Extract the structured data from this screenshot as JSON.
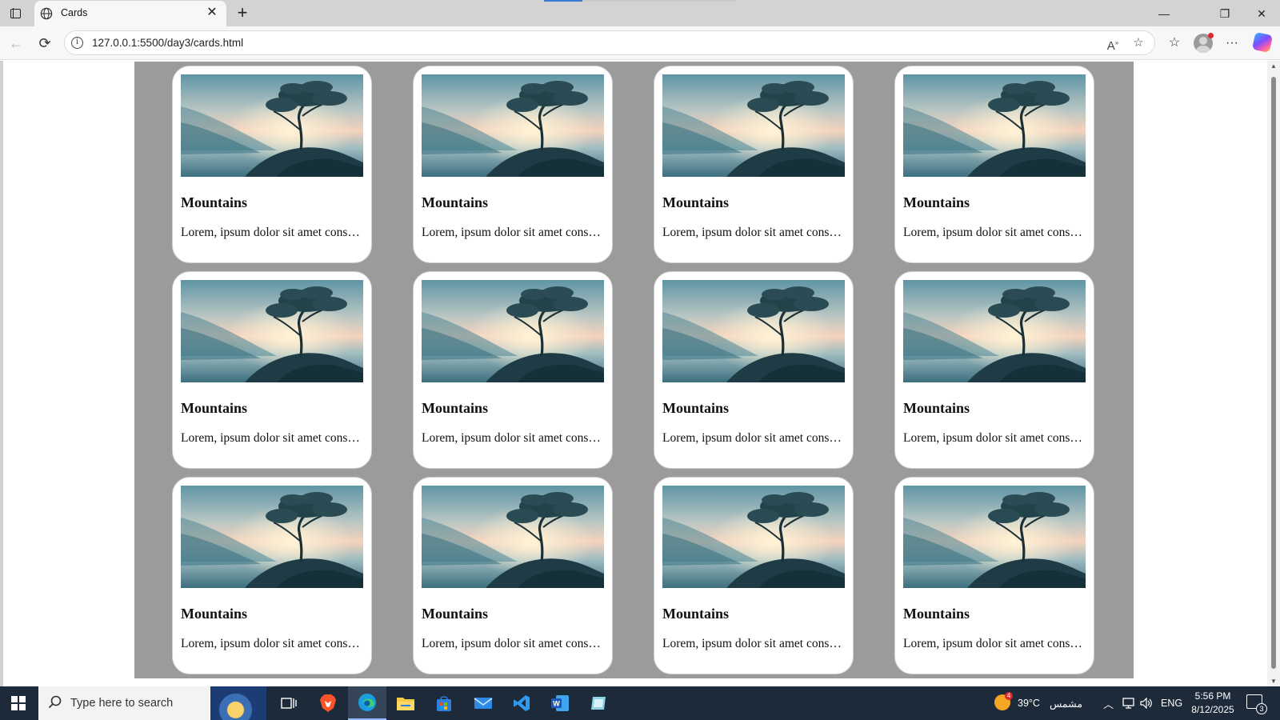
{
  "browser": {
    "tab_title": "Cards",
    "new_tab_label": "+",
    "tab_close_label": "✕",
    "url": "127.0.0.1:5500/day3/cards.html",
    "window_controls": {
      "minimize": "—",
      "restore": "❐",
      "close": "✕"
    },
    "icons": [
      "back-arrow-icon",
      "refresh-icon",
      "info-icon",
      "read-aloud-icon",
      "favorite-star-icon",
      "favorites-icon",
      "profile-icon",
      "more-icon",
      "copilot-icon"
    ]
  },
  "cards": [
    {
      "title": "Mountains",
      "text": "Lorem, ipsum dolor sit amet consectetur adipisicing elit."
    },
    {
      "title": "Mountains",
      "text": "Lorem, ipsum dolor sit amet consectetur adipisicing elit."
    },
    {
      "title": "Mountains",
      "text": "Lorem, ipsum dolor sit amet consectetur adipisicing elit."
    },
    {
      "title": "Mountains",
      "text": "Lorem, ipsum dolor sit amet consectetur adipisicing elit."
    },
    {
      "title": "Mountains",
      "text": "Lorem, ipsum dolor sit amet consectetur adipisicing elit."
    },
    {
      "title": "Mountains",
      "text": "Lorem, ipsum dolor sit amet consectetur adipisicing elit."
    },
    {
      "title": "Mountains",
      "text": "Lorem, ipsum dolor sit amet consectetur adipisicing elit."
    },
    {
      "title": "Mountains",
      "text": "Lorem, ipsum dolor sit amet consectetur adipisicing elit."
    },
    {
      "title": "Mountains",
      "text": "Lorem, ipsum dolor sit amet consectetur adipisicing elit."
    },
    {
      "title": "Mountains",
      "text": "Lorem, ipsum dolor sit amet consectetur adipisicing elit."
    },
    {
      "title": "Mountains",
      "text": "Lorem, ipsum dolor sit amet consectetur adipisicing elit."
    },
    {
      "title": "Mountains",
      "text": "Lorem, ipsum dolor sit amet consectetur adipisicing elit."
    }
  ],
  "colors": {
    "page_container": "#9b9b9b",
    "card_background": "#ffffff",
    "taskbar": "#1d2a3a"
  },
  "taskbar": {
    "search_placeholder": "Type here to search",
    "weather_temp": "39°C",
    "weather_label": "مشمس",
    "weather_badge": "4",
    "language": "ENG",
    "time": "5:56 PM",
    "date": "8/12/2025",
    "notification_count": "3",
    "apps": [
      "task-view-icon",
      "brave-browser-icon",
      "edge-browser-icon",
      "file-explorer-icon",
      "microsoft-store-icon",
      "mail-icon",
      "vscode-icon",
      "word-icon",
      "app-icon"
    ]
  }
}
